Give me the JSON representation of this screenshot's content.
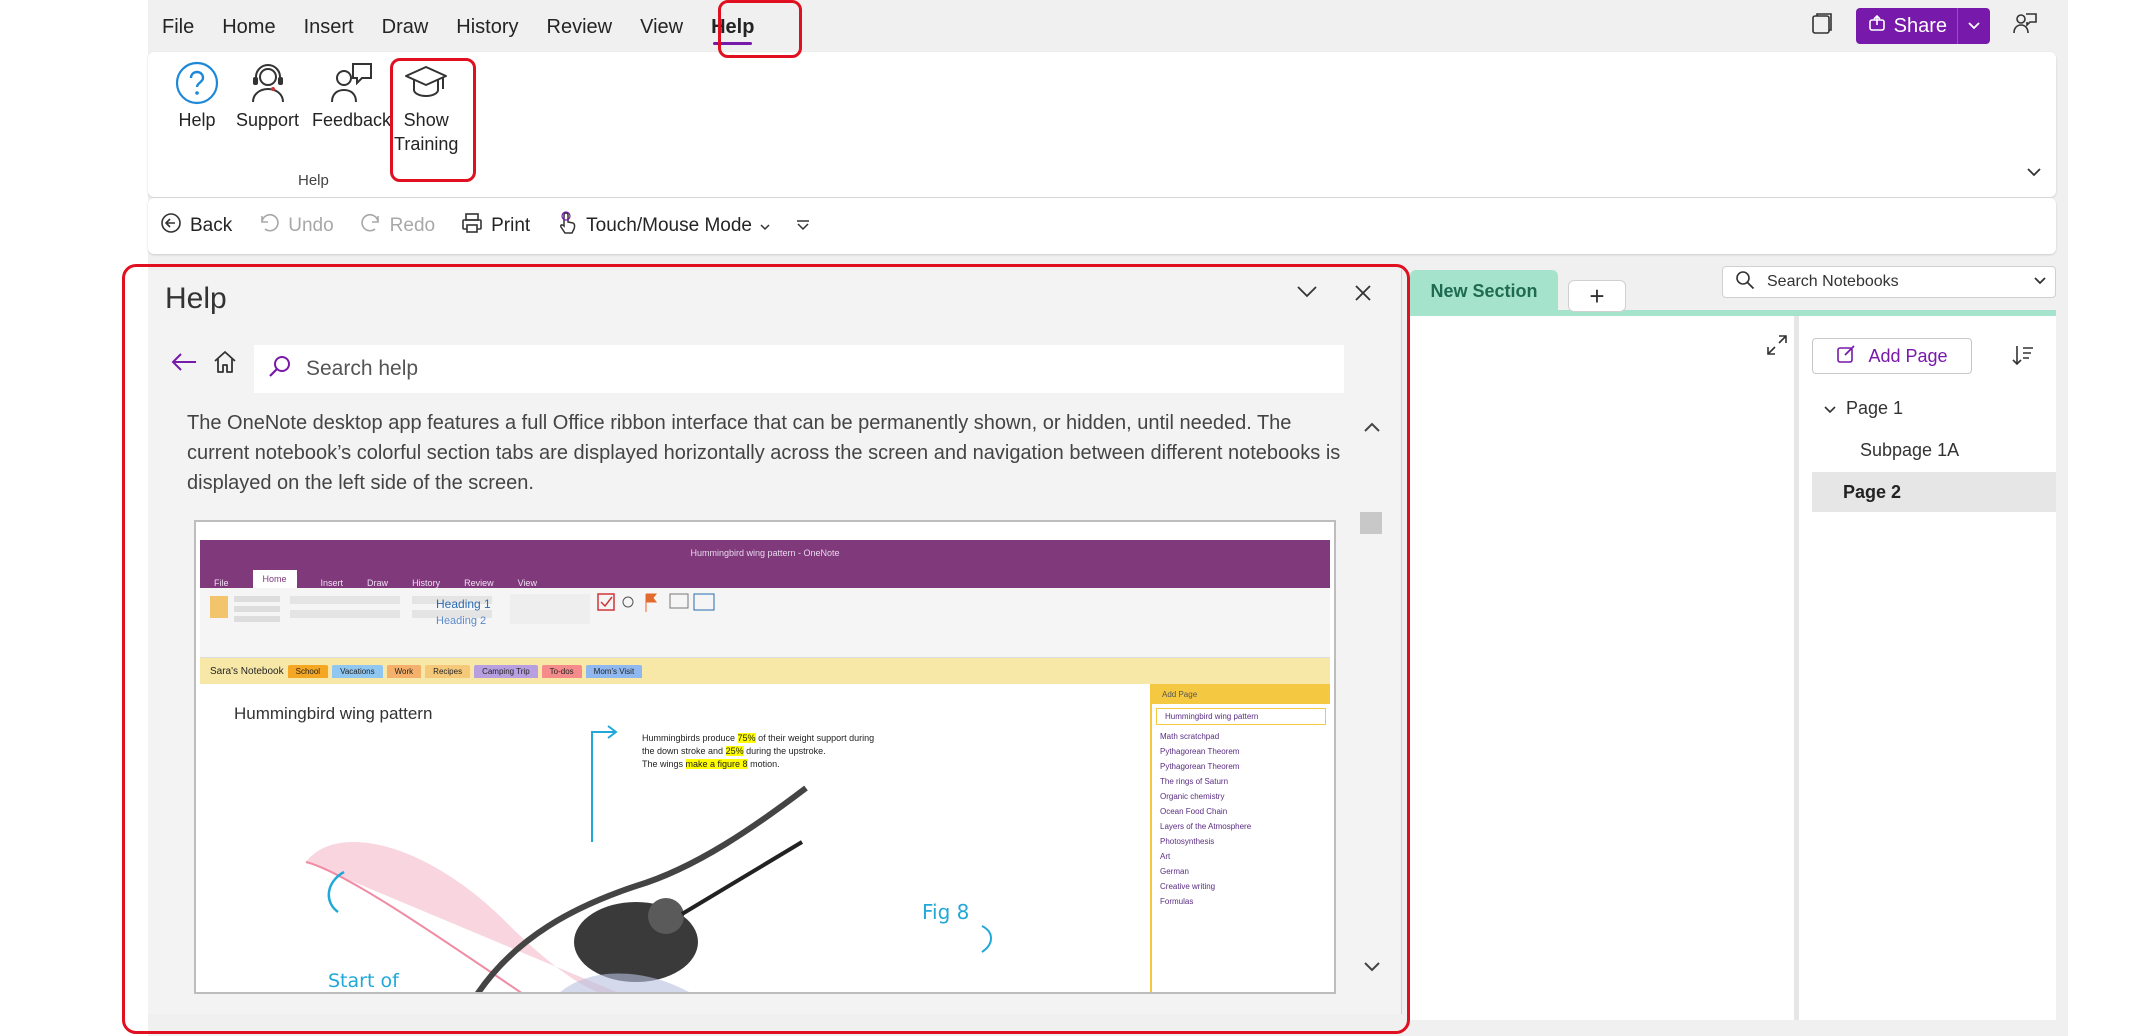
{
  "menu": {
    "items": [
      "File",
      "Home",
      "Insert",
      "Draw",
      "History",
      "Review",
      "View",
      "Help"
    ],
    "active": "Help",
    "share_label": "Share"
  },
  "ribbon": {
    "buttons": [
      {
        "label": "Help",
        "icon": "help-circle-icon"
      },
      {
        "label": "Support",
        "icon": "headset-icon"
      },
      {
        "label": "Feedback",
        "icon": "feedback-person-icon"
      },
      {
        "label_line1": "Show",
        "label_line2": "Training",
        "icon": "graduation-cap-icon"
      }
    ],
    "group_label": "Help"
  },
  "qat": {
    "back": "Back",
    "undo": "Undo",
    "redo": "Redo",
    "print": "Print",
    "touch": "Touch/Mouse Mode"
  },
  "help_pane": {
    "title": "Help",
    "search_placeholder": "Search help",
    "body_text": "The OneNote desktop app features a full Office ribbon interface that can be permanently shown, or hidden, until needed. The current notebook’s colorful section tabs are displayed horizontally across the screen and navigation between different notebooks is displayed on the left side of the screen.",
    "screenshot": {
      "window_title": "Hummingbird wing pattern - OneNote",
      "tabs": [
        "File",
        "Home",
        "Insert",
        "Draw",
        "History",
        "Review",
        "View"
      ],
      "notebook": "Sara's Notebook",
      "sections": [
        {
          "name": "School",
          "color": "#f5a623"
        },
        {
          "name": "Vacations",
          "color": "#8fc7f0"
        },
        {
          "name": "Work",
          "color": "#f5b16b"
        },
        {
          "name": "Recipes",
          "color": "#f5c87a"
        },
        {
          "name": "Camping Trip",
          "color": "#b8a0e0"
        },
        {
          "name": "To-dos",
          "color": "#f58b8b"
        },
        {
          "name": "Mom's Visit",
          "color": "#8fb8f0"
        }
      ],
      "page_title": "Hummingbird wing pattern",
      "note_line1_a": "Hummingbirds produce ",
      "note_line1_b": "75%",
      "note_line1_c": " of their weight support during",
      "note_line2_a": "the down stroke and ",
      "note_line2_b": "25%",
      "note_line2_c": " during the upstroke.",
      "note_line3_a": "The wings ",
      "note_line3_b": "make a figure 8",
      "note_line3_c": " motion.",
      "add_page": "Add Page",
      "pages": [
        "Hummingbird wing pattern",
        "Math scratchpad",
        "Pythagorean Theorem",
        "Pythagorean Theorem",
        "The rings of Saturn",
        "Organic chemistry",
        "Ocean Food Chain",
        "Layers of the Atmosphere",
        "Photosynthesis",
        "Art",
        "German",
        "Creative writing",
        "Formulas"
      ],
      "fig_label": "Fig 8",
      "start_label": "Start of"
    }
  },
  "section": {
    "current": "New Section",
    "add_label": "+"
  },
  "search_notebooks": "Search Notebooks",
  "pages_pane": {
    "add_page": "Add Page",
    "pages": [
      {
        "label": "Page 1"
      },
      {
        "label": "Subpage 1A"
      },
      {
        "label": "Page 2"
      }
    ]
  },
  "colors": {
    "accent": "#7719aa",
    "highlight_box": "#e01020",
    "section_tab": "#a6e3cd"
  }
}
